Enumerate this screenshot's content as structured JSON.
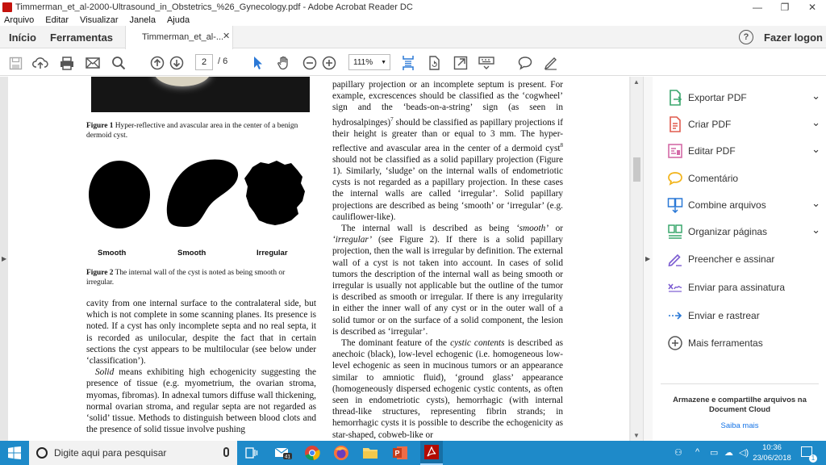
{
  "window": {
    "title": "Timmerman_et_al-2000-Ultrasound_in_Obstetrics_%26_Gynecology.pdf - Adobe Acrobat Reader DC",
    "minimize": "—",
    "maximize": "❐",
    "close": "✕"
  },
  "menu": [
    "Arquivo",
    "Editar",
    "Visualizar",
    "Janela",
    "Ajuda"
  ],
  "tabs": {
    "home": "Início",
    "tools": "Ferramentas",
    "document": "Timmerman_et_al-...",
    "close": "✕",
    "help": "?",
    "login": "Fazer logon"
  },
  "toolbar": {
    "page_current": "2",
    "page_total": "/ 6",
    "zoom": "111%"
  },
  "document": {
    "fig1_label": "Figure 1",
    "fig1_text": "Hyper-reflective and avascular area in the center of a benign dermoid cyst.",
    "fig2_labels": [
      "Smooth",
      "Smooth",
      "Irregular"
    ],
    "fig2_label": "Figure 2",
    "fig2_text": "The internal wall of the cyst is noted as being smooth or irregular.",
    "left_col_p1": "cavity from one internal surface to the contralateral side, but which is not complete in some scanning planes. Its presence is noted. If a cyst has only incomplete septa and no real septa, it is recorded as unilocular, despite the fact that in certain sections the cyst appears to be multilocular (see below under ‘classification’).",
    "left_col_p2_em": "Solid",
    "left_col_p2": " means exhibiting high echogenicity suggesting the presence of tissue (e.g. myometrium, the ovarian stroma, myomas, fibromas). In adnexal tumors diffuse wall thickening, normal ovarian stroma, and regular septa are not regarded as ‘solid’ tissue. Methods to distinguish between blood clots and the presence of solid tissue involve pushing",
    "right_col_p1a": "papillary projection or an incomplete septum is present. For example, excrescences should be classified as the ‘cogwheel’ sign and the ‘beads-on-a-string’ sign (as seen in hydrosalpinges)",
    "right_col_sup1": "7",
    "right_col_p1b": " should be classified as papillary projections if their height is greater than or equal to 3 mm. The hyper-reflective and avascular area in the center of a dermoid cyst",
    "right_col_sup2": "8",
    "right_col_p1c": " should not be classified as a solid papillary projection (Figure 1). Similarly, ‘sludge’ on the internal walls of endometriotic cysts is not regarded as a papillary projection. In these cases the internal walls are called ‘irregular’. Solid papillary projections are described as being ‘smooth’ or ‘irregular’ (e.g. cauliflower-like).",
    "right_col_p2a": "The internal wall is described as being ",
    "right_col_p2_em1": "‘smooth’",
    "right_col_p2b": " or ",
    "right_col_p2_em2": "‘irregular’",
    "right_col_p2c": " (see Figure 2). If there is a solid papillary projection, then the wall is irregular by definition. The external wall of a cyst is not taken into account. In cases of solid tumors the description of the internal wall as being smooth or irregular is usually not applicable but the outline of the tumor is described as smooth or irregular. If there is any irregularity in either the inner wall of any cyst or in the outer wall of a solid tumor or on the surface of a solid component, the lesion is described as ‘irregular’.",
    "right_col_p3a": "The dominant feature of the ",
    "right_col_p3_em": "cystic contents",
    "right_col_p3b": " is described as anechoic (black), low-level echogenic (i.e. homogeneous low-level echogenic as seen in mucinous tumors or an appearance similar to amniotic fluid), ‘ground glass’ appearance (homogeneously dispersed echogenic cystic contents, as often seen in endometriotic cysts), hemorrhagic (with internal thread-like structures, representing fibrin strands; in hemorrhagic cysts it is possible to describe the echogenicity as star-shaped, cobweb-like or"
  },
  "right_panel": {
    "items": [
      {
        "label": "Exportar PDF",
        "icon": "export-pdf-icon",
        "color": "#3aa76d",
        "chevron": "⌄"
      },
      {
        "label": "Criar PDF",
        "icon": "create-pdf-icon",
        "color": "#e05c4f",
        "chevron": "⌄"
      },
      {
        "label": "Editar PDF",
        "icon": "edit-pdf-icon",
        "color": "#d46aa7",
        "chevron": "⌄"
      },
      {
        "label": "Comentário",
        "icon": "comment-icon",
        "color": "#f2b318",
        "chevron": ""
      },
      {
        "label": "Combine arquivos",
        "icon": "combine-files-icon",
        "color": "#2a78d6",
        "chevron": "⌄"
      },
      {
        "label": "Organizar páginas",
        "icon": "organize-pages-icon",
        "color": "#3aa76d",
        "chevron": "⌄"
      },
      {
        "label": "Preencher e assinar",
        "icon": "fill-sign-icon",
        "color": "#7b5bd1",
        "chevron": ""
      },
      {
        "label": "Enviar para assinatura",
        "icon": "send-signature-icon",
        "color": "#7b5bd1",
        "chevron": ""
      },
      {
        "label": "Enviar e rastrear",
        "icon": "send-track-icon",
        "color": "#2a78d6",
        "chevron": ""
      },
      {
        "label": "Mais ferramentas",
        "icon": "more-tools-icon",
        "color": "#555555",
        "chevron": ""
      }
    ],
    "footer_text": "Armazene e compartilhe arquivos na Document Cloud",
    "footer_link": "Saiba mais"
  },
  "taskbar": {
    "search_placeholder": "Digite aqui para pesquisar",
    "mail_badge": "41",
    "time": "10:36",
    "date": "23/06/2018",
    "notif_count": "1"
  }
}
